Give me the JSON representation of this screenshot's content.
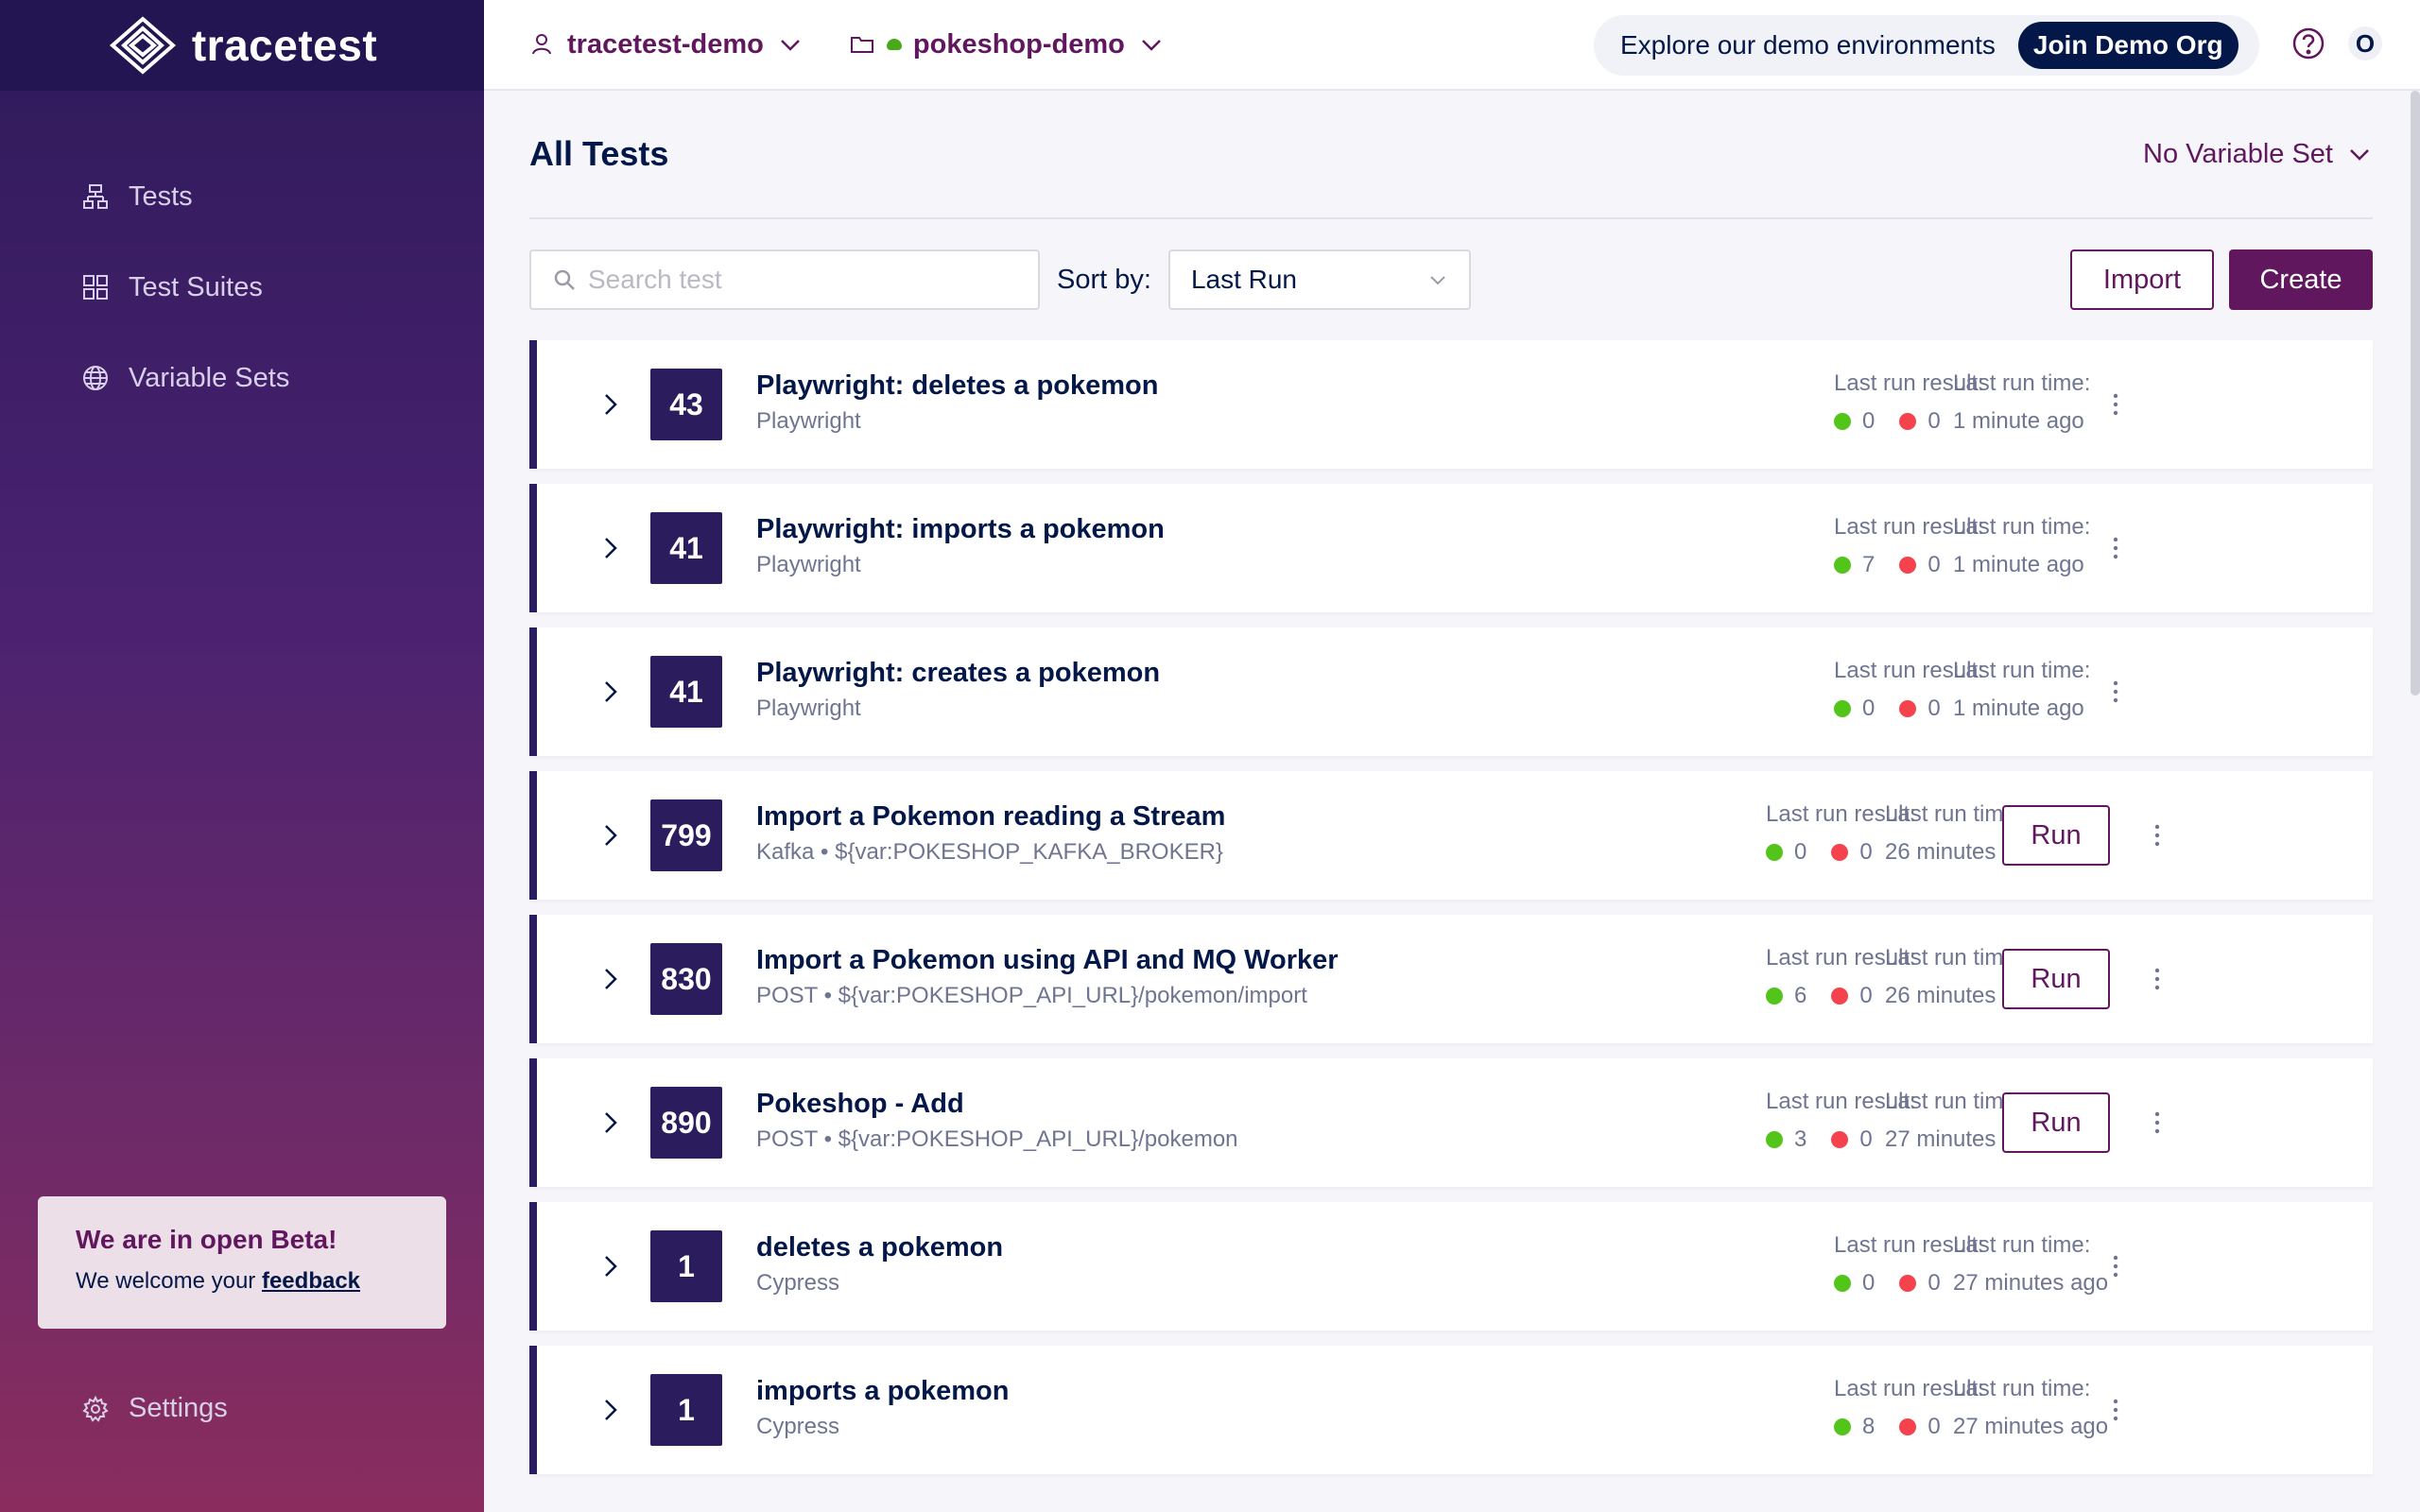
{
  "brand": {
    "name": "tracetest"
  },
  "sidebar": {
    "items": [
      {
        "label": "Tests",
        "icon": "tests-icon"
      },
      {
        "label": "Test Suites",
        "icon": "test-suites-icon"
      },
      {
        "label": "Variable Sets",
        "icon": "globe-icon"
      }
    ],
    "beta": {
      "title": "We are in open Beta!",
      "text": "We welcome your ",
      "link": "feedback"
    },
    "settings": "Settings"
  },
  "header": {
    "org": "tracetest-demo",
    "env": "pokeshop-demo",
    "demo_text": "Explore our demo environments",
    "demo_button": "Join Demo Org",
    "avatar": "O"
  },
  "main": {
    "title": "All Tests",
    "variable_set": "No Variable Set",
    "search_placeholder": "Search test",
    "sort_label": "Sort by:",
    "sort_value": "Last Run",
    "import_label": "Import",
    "create_label": "Create",
    "result_label": "Last run result:",
    "time_label": "Last run time:",
    "run_label": "Run",
    "tests": [
      {
        "runs": "43",
        "name": "Playwright: deletes a pokemon",
        "sub": "Playwright",
        "pass": "0",
        "fail": "0",
        "time": "1 minute ago",
        "runnable": false
      },
      {
        "runs": "41",
        "name": "Playwright: imports a pokemon",
        "sub": "Playwright",
        "pass": "7",
        "fail": "0",
        "time": "1 minute ago",
        "runnable": false
      },
      {
        "runs": "41",
        "name": "Playwright: creates a pokemon",
        "sub": "Playwright",
        "pass": "0",
        "fail": "0",
        "time": "1 minute ago",
        "runnable": false
      },
      {
        "runs": "799",
        "name": "Import a Pokemon reading a Stream",
        "sub": "Kafka • ${var:POKESHOP_KAFKA_BROKER}",
        "pass": "0",
        "fail": "0",
        "time": "26 minutes ago",
        "runnable": true
      },
      {
        "runs": "830",
        "name": "Import a Pokemon using API and MQ Worker",
        "sub": "POST • ${var:POKESHOP_API_URL}/pokemon/import",
        "pass": "6",
        "fail": "0",
        "time": "26 minutes ago",
        "runnable": true
      },
      {
        "runs": "890",
        "name": "Pokeshop - Add",
        "sub": "POST • ${var:POKESHOP_API_URL}/pokemon",
        "pass": "3",
        "fail": "0",
        "time": "27 minutes ago",
        "runnable": true
      },
      {
        "runs": "1",
        "name": "deletes a pokemon",
        "sub": "Cypress",
        "pass": "0",
        "fail": "0",
        "time": "27 minutes ago",
        "runnable": false
      },
      {
        "runs": "1",
        "name": "imports a pokemon",
        "sub": "Cypress",
        "pass": "8",
        "fail": "0",
        "time": "27 minutes ago",
        "runnable": false
      }
    ]
  },
  "colors": {
    "primary": "#61175e",
    "navy": "#031849",
    "badge": "#2b1c5e",
    "pass": "#52c41a",
    "fail": "#f5424d"
  }
}
